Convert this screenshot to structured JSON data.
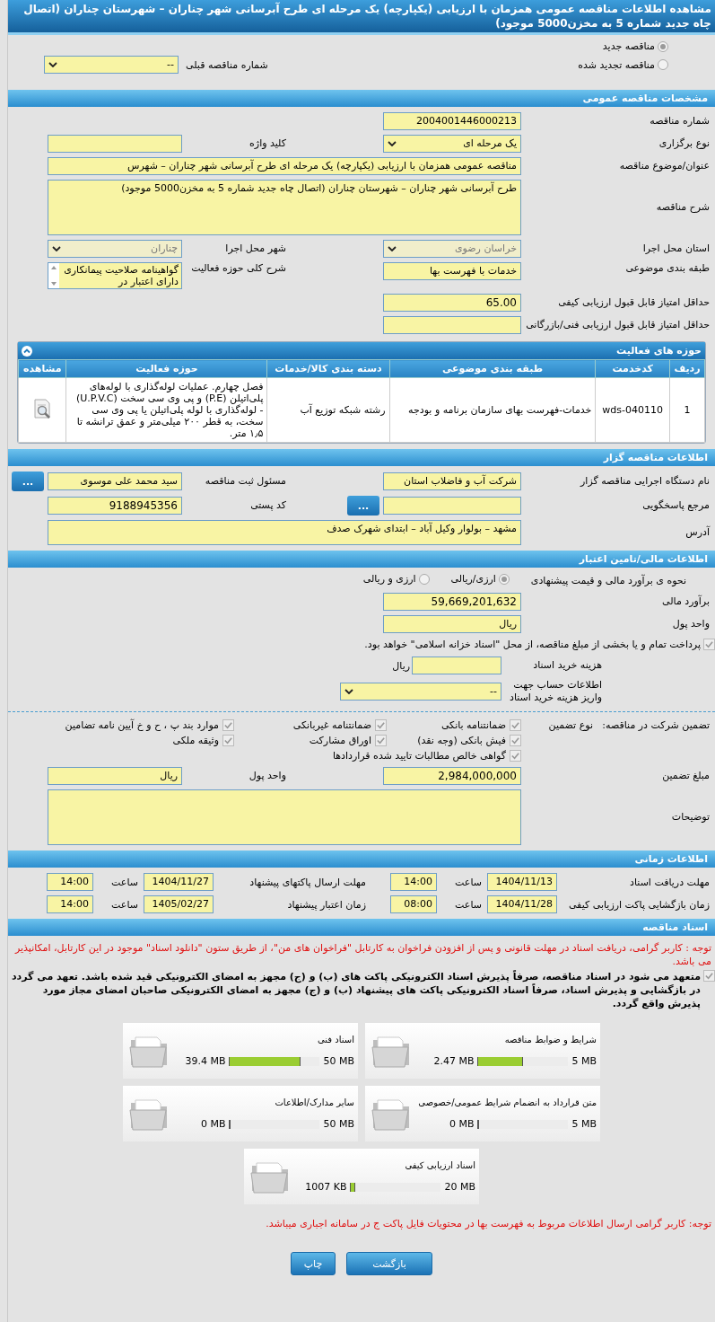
{
  "title": "مشاهده اطلاعات مناقصه عمومی همزمان با ارزیابی (یکپارچه) یک مرحله ای طرح آبرسانی شهر چناران – شهرستان چناران (اتصال چاه جدید شماره 5 به مخزن5000 موجود)",
  "tender_type": {
    "options": [
      {
        "label": "مناقصه جدید",
        "selected": true
      },
      {
        "label": "مناقصه تجدید شده",
        "selected": false
      }
    ],
    "previous_label": "شماره مناقصه قبلی",
    "previous_value": "--"
  },
  "general": {
    "heading": "مشخصات مناقصه عمومی",
    "number_label": "شماره مناقصه",
    "number": "2004001446000213",
    "holding_type_label": "نوع برگزاری",
    "holding_type": "یک مرحله ای",
    "keyword_label": "کلید واژه",
    "subject_label": "عنوان/موضوع مناقصه",
    "subject": "مناقصه عمومی همزمان با ارزیابی (یکپارچه) یک مرحله ای طرح آبرسانی شهر چناران – شهرس",
    "description_label": "شرح مناقصه",
    "description": "طرح آبرسانی شهر چناران – شهرستان چناران (اتصال چاه جدید شماره 5 به مخزن5000 موجود)",
    "province_label": "استان محل اجرا",
    "province": "خراسان رضوی",
    "city_label": "شهر محل اجرا",
    "city": "چناران",
    "category_label": "طبقه بندی موضوعی",
    "category": "خدمات با فهرست بها",
    "scope_label": "شرح کلی حوزه فعالیت",
    "scope": "گواهینامه صلاحیت پیمانکاری  دارای اعتبار در",
    "min_quality_label": "حداقل امتیاز قابل قبول ارزیابی کیفی",
    "min_quality": "65.00",
    "min_tech_label": "حداقل امتیاز قابل قبول ارزیابی فنی/بازرگانی"
  },
  "activities": {
    "heading": "حوزه های فعالیت",
    "expanded": true,
    "columns": [
      "ردیف",
      "کدخدمت",
      "طبقه بندی موضوعی",
      "دسته بندی کالا/خدمات",
      "حوزه فعالیت",
      "مشاهده"
    ],
    "rows": [
      {
        "row": "1",
        "code": "wds-040110",
        "category": "خدمات-فهرست بهای سازمان برنامه و بودجه",
        "goods": "رشته شبکه توزیع آب",
        "scope": "فصل چهارم. عملیات لوله‌گذاری با لوله‌های پلی‌اتیلن (P.E) و پی وی سی سخت (U.P.V.C) - لوله‌گذاری با لوله پلی‌اتیلن یا پی وی سی سخت، به قطر ۲۰۰ میلی‌متر و عمق ترانشه تا ۱٫۵ متر."
      }
    ]
  },
  "organizer": {
    "heading": "اطلاعات مناقصه گزار",
    "agency_label": "نام دستگاه اجرایی مناقصه گزار",
    "agency": "شرکت آب و فاضلاب استان",
    "registrar_label": "مسئول ثبت مناقصه",
    "registrar": "سید محمد علی موسوی",
    "registrar_button": "...",
    "reference_label": "مرجع پاسخگویی",
    "reference_button": "...",
    "postal_label": "کد پستی",
    "postal": "9188945356",
    "address_label": "آدرس",
    "address": "مشهد – بولوار وکیل آباد – ابتدای شهرک صدف"
  },
  "finance": {
    "heading": "اطلاعات مالی/تامین اعتبار",
    "method_label": "نحوه ی برآورد مالی و قیمت پیشنهادی",
    "methods": [
      {
        "label": "ارزی/ریالی",
        "selected": true
      },
      {
        "label": "ارزی و ریالی",
        "selected": false
      }
    ],
    "estimate_label": "برآورد مالی",
    "estimate": "59,669,201,632",
    "currency_label": "واحد پول",
    "currency": "ریال",
    "treasury_checked": true,
    "treasury_text": "پرداخت تمام و یا بخشی از مبلغ مناقصه، از محل \"اسناد خزانه اسلامی\" خواهد بود.",
    "doc_fee_label": "هزینه خرید اسناد",
    "doc_fee_unit": "ریال",
    "account_label": "اطلاعات حساب جهت واریز هزینه خرید اسناد",
    "account": "--"
  },
  "guarantee": {
    "label": "تضمین شرکت در مناقصه:",
    "type_label": "نوع تضمین",
    "types": [
      {
        "label": "ضمانتنامه بانکی",
        "checked": true
      },
      {
        "label": "ضمانتنامه غیربانکی",
        "checked": true
      },
      {
        "label": "موارد بند پ ، ح و خ آیین نامه تضامین",
        "checked": true
      },
      {
        "label": "فیش بانکی (وجه نقد)",
        "checked": true
      },
      {
        "label": "اوراق مشارکت",
        "checked": true
      },
      {
        "label": "وثیقه ملکی",
        "checked": true
      },
      {
        "label": "گواهی خالص مطالبات تایید شده قراردادها",
        "checked": true
      }
    ],
    "amount_label": "مبلغ تضمین",
    "amount": "2,984,000,000",
    "currency_label": "واحد پول",
    "currency": "ریال",
    "notes_label": "توضیحات"
  },
  "schedule": {
    "heading": "اطلاعات زمانی",
    "items": [
      {
        "label": "مهلت دریافت اسناد",
        "date": "1404/11/13",
        "time_label": "ساعت",
        "time": "14:00"
      },
      {
        "label": "مهلت ارسال پاکتهای پیشنهاد",
        "date": "1404/11/27",
        "time_label": "ساعت",
        "time": "14:00"
      },
      {
        "label": "زمان بازگشایی پاکت ارزیابی کیفی",
        "date": "1404/11/28",
        "time_label": "ساعت",
        "time": "08:00"
      },
      {
        "label": "زمان اعتبار پیشنهاد",
        "date": "1405/02/27",
        "time_label": "ساعت",
        "time": "14:00"
      }
    ]
  },
  "documents": {
    "heading": "اسناد مناقصه",
    "notice": "توجه : کاربر گرامی، دریافت اسناد در مهلت قانونی و پس از افزودن فراخوان به کارتابل \"فراخوان های من\"، از طریق ستون \"دانلود اسناد\" موجود در این کارتابل، امکانپذیر می باشد.",
    "commitment_checked": true,
    "commitment": "متعهد می شود در اسناد مناقصه، صرفاً پذیرش اسناد الکترونیکی پاکت های (ب) و (ج) مجهز به امضای الکترونیکی قید شده باشد. تعهد می گردد در بازگشایی و پذیرش اسناد، صرفاً اسناد الکترونیکی پاکت های پیشنهاد (ب) و (ج) مجهز به امضای الکترونیکی صاحبان امضای مجاز مورد پذیرش واقع گردد.",
    "folders": [
      {
        "name": "شرایط و ضوابط مناقصه",
        "max": "5 MB",
        "used": "2.47 MB",
        "level": 0.494
      },
      {
        "name": "اسناد فنی",
        "max": "50 MB",
        "used": "39.4 MB",
        "level": 0.788
      },
      {
        "name": "متن قرارداد به انضمام شرایط عمومی/خصوصی",
        "max": "5 MB",
        "used": "0 MB",
        "level": 0
      },
      {
        "name": "سایر مدارک/اطلاعات",
        "max": "50 MB",
        "used": "0 MB",
        "level": 0
      },
      {
        "name": "اسناد ارزیابی کیفی",
        "max": "20 MB",
        "used": "1007 KB",
        "level": 0.049
      }
    ],
    "footer_note": "توجه: کاربر گرامی ارسال اطلاعات مربوط به فهرست بها در محتویات فایل پاکت ج در سامانه اجباری میباشد."
  },
  "buttons": [
    "بازگشت",
    "چاپ"
  ]
}
